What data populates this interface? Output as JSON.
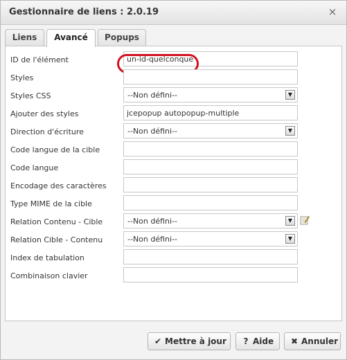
{
  "dialog": {
    "title": "Gestionnaire de liens : 2.0.19",
    "close_icon": "×"
  },
  "tabs": [
    {
      "label": "Liens",
      "active": false
    },
    {
      "label": "Avancé",
      "active": true
    },
    {
      "label": "Popups",
      "active": false
    }
  ],
  "form": {
    "id": {
      "label": "ID de l'élément",
      "value": "un-id-quelconque"
    },
    "styles": {
      "label": "Styles",
      "value": ""
    },
    "css": {
      "label": "Styles CSS",
      "value": "--Non défini--"
    },
    "add_styles": {
      "label": "Ajouter des styles",
      "value": "jcepopup autopopup-multiple"
    },
    "direction": {
      "label": "Direction d'écriture",
      "value": "--Non défini--"
    },
    "target_lang": {
      "label": "Code langue de la cible",
      "value": ""
    },
    "lang": {
      "label": "Code langue",
      "value": ""
    },
    "charset": {
      "label": "Encodage des caractères",
      "value": ""
    },
    "mime": {
      "label": "Type MIME de la cible",
      "value": ""
    },
    "rel": {
      "label": "Relation Contenu - Cible",
      "value": "--Non défini--"
    },
    "rev": {
      "label": "Relation Cible - Contenu",
      "value": "--Non défini--"
    },
    "tabindex": {
      "label": "Index de tabulation",
      "value": ""
    },
    "accesskey": {
      "label": "Combinaison clavier",
      "value": ""
    }
  },
  "buttons": {
    "update": {
      "label": "Mettre à jour",
      "icon": "✔"
    },
    "help": {
      "label": "Aide",
      "icon": "?"
    },
    "cancel": {
      "label": "Annuler",
      "icon": "✖"
    }
  },
  "colors": {
    "highlight": "#d0101f"
  }
}
